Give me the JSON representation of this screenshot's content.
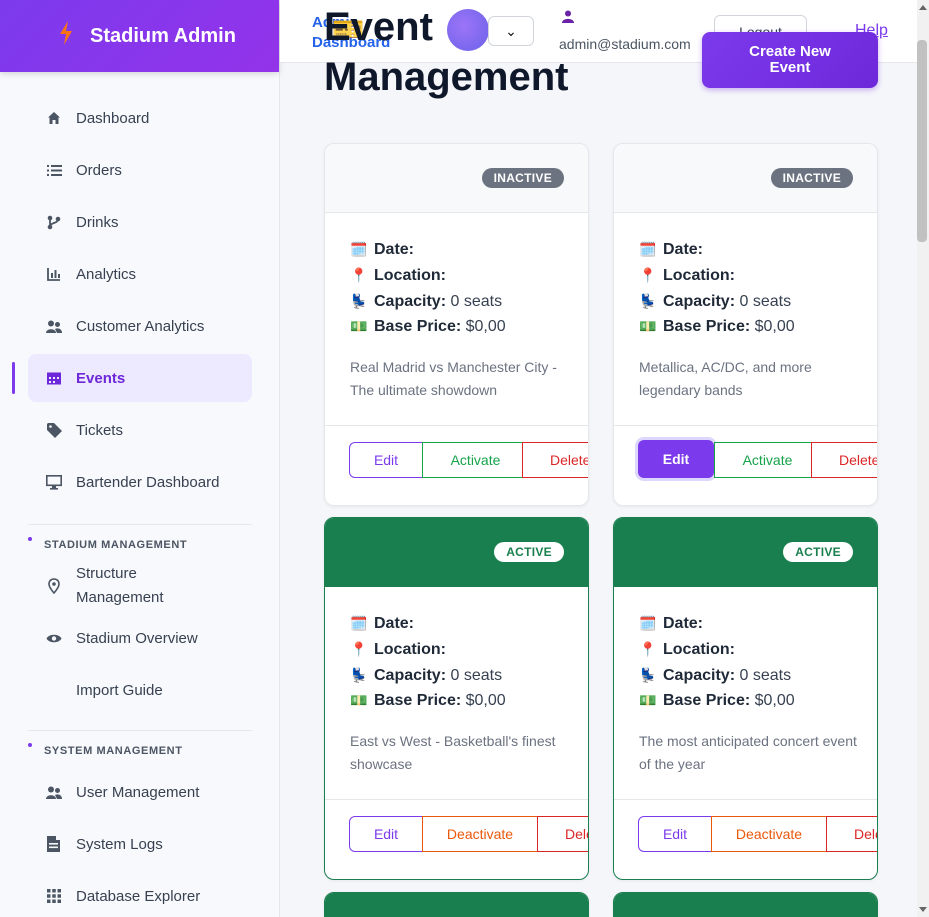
{
  "brand": {
    "title": "Stadium Admin"
  },
  "sidebar": {
    "items": [
      {
        "label": "Dashboard",
        "icon": "home-icon"
      },
      {
        "label": "Orders",
        "icon": "list-icon"
      },
      {
        "label": "Drinks",
        "icon": "branch-icon"
      },
      {
        "label": "Analytics",
        "icon": "bar-chart-icon"
      },
      {
        "label": "Customer Analytics",
        "icon": "users-icon"
      },
      {
        "label": "Events",
        "icon": "calendar-icon",
        "active": true
      },
      {
        "label": "Tickets",
        "icon": "tag-icon"
      },
      {
        "label": "Bartender Dashboard",
        "icon": "monitor-icon"
      }
    ],
    "stadium_section": {
      "title": "STADIUM MANAGEMENT",
      "items": [
        {
          "label_line1": "Structure",
          "label_line2": "Management",
          "icon": "map-pin-icon"
        },
        {
          "label": "Stadium Overview",
          "icon": "eye-icon"
        },
        {
          "label": "Import Guide"
        }
      ]
    },
    "system_section": {
      "title": "SYSTEM MANAGEMENT",
      "items": [
        {
          "label": "User Management",
          "icon": "users-icon"
        },
        {
          "label": "System Logs",
          "icon": "log-icon"
        },
        {
          "label": "Database Explorer",
          "icon": "grid-icon"
        }
      ]
    }
  },
  "header": {
    "breadcrumb": "Admin Dashboard",
    "page_title": "Event Management",
    "user_email": "admin@stadium.com",
    "logout_label": "Logout",
    "help_label": "Help",
    "create_label": "Create New Event",
    "select_symbol": "⌄"
  },
  "labels": {
    "date": "Date:",
    "location": "Location:",
    "capacity": "Capacity:",
    "base_price": "Base Price:",
    "edit": "Edit",
    "activate": "Activate",
    "deactivate": "Deactivate",
    "delete": "Delete"
  },
  "events": [
    {
      "status": "INACTIVE",
      "capacity": "0 seats",
      "price": "$0,00",
      "description": "Real Madrid vs Manchester City - The ultimate showdown"
    },
    {
      "status": "INACTIVE",
      "capacity": "0 seats",
      "price": "$0,00",
      "description": "Metallica, AC/DC, and more legendary bands"
    },
    {
      "status": "ACTIVE",
      "capacity": "0 seats",
      "price": "$0,00",
      "description": "East vs West - Basketball's finest showcase"
    },
    {
      "status": "ACTIVE",
      "capacity": "0 seats",
      "price": "$0,00",
      "description": "The most anticipated concert event of the year"
    }
  ],
  "colors": {
    "accent": "#7c3aed",
    "active_green": "#1a7f4e",
    "inactive_gray": "#6b7280"
  }
}
